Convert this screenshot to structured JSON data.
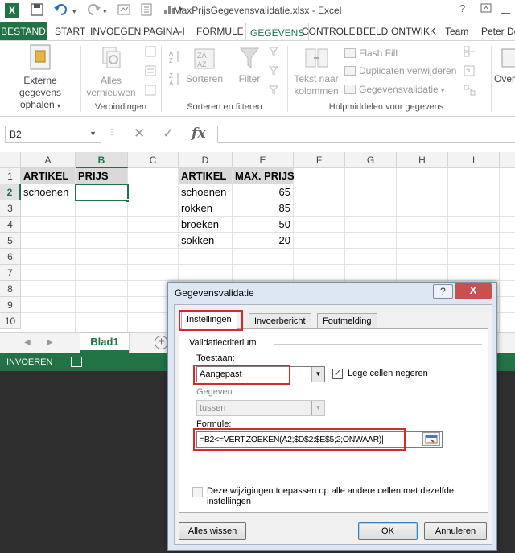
{
  "titlebar": {
    "title": "MaxPrijsGegevensvalidatie.xlsx - Excel",
    "help": "?"
  },
  "tabs": [
    "BESTAND",
    "START",
    "INVOEGEN",
    "PAGINA-I",
    "FORMULE",
    "GEGEVENS",
    "CONTROLE",
    "BEELD",
    "ONTWIKK",
    "Team",
    "Peter De"
  ],
  "active_tab": "GEGEVENS",
  "ribbon": {
    "external_data_line1": "Externe gegevens",
    "external_data_line2": "ophalen",
    "refresh_all_line1": "Alles",
    "refresh_all_line2": "vernieuwen",
    "group_connections": "Verbindingen",
    "sort": "Sorteren",
    "filter": "Filter",
    "group_sort_filter": "Sorteren en filteren",
    "text_to_columns_line1": "Tekst naar",
    "text_to_columns_line2": "kolommen",
    "flash_fill": "Flash Fill",
    "remove_duplicates": "Duplicaten verwijderen",
    "data_validation": "Gegevensvalidatie",
    "group_data_tools": "Hulpmiddelen voor gegevens",
    "overflow": "Over"
  },
  "formula_bar": {
    "name_box": "B2",
    "formula": ""
  },
  "sheet": {
    "columns": [
      "A",
      "B",
      "C",
      "D",
      "E",
      "F",
      "G",
      "H",
      "I"
    ],
    "rows": [
      "1",
      "2",
      "3",
      "4",
      "5",
      "6",
      "7",
      "8",
      "9",
      "10"
    ],
    "a1": "ARTIKEL",
    "b1": "PRIJS",
    "a2": "schoenen",
    "d1": "ARTIKEL",
    "e1": "MAX. PRIJS",
    "table": [
      {
        "item": "schoenen",
        "max": "65"
      },
      {
        "item": "rokken",
        "max": "85"
      },
      {
        "item": "broeken",
        "max": "50"
      },
      {
        "item": "sokken",
        "max": "20"
      }
    ]
  },
  "sheet_tab": "Blad1",
  "status": {
    "mode": "INVOEREN"
  },
  "dialog": {
    "title": "Gegevensvalidatie",
    "help": "?",
    "close": "X",
    "tabs": [
      "Instellingen",
      "Invoerbericht",
      "Foutmelding"
    ],
    "section": "Validatiecriterium",
    "allow_label": "Toestaan:",
    "allow_value": "Aangepast",
    "ignore_blank": "Lege cellen negeren",
    "data_label": "Gegeven:",
    "data_value": "tussen",
    "formula_label": "Formule:",
    "formula_value": "=B2<=VERT.ZOEKEN(A2;$D$2:$E$5;2;ONWAAR)",
    "apply_all": "Deze wijzigingen toepassen op alle andere cellen met dezelfde instellingen",
    "clear_all": "Alles wissen",
    "ok": "OK",
    "cancel": "Annuleren"
  }
}
